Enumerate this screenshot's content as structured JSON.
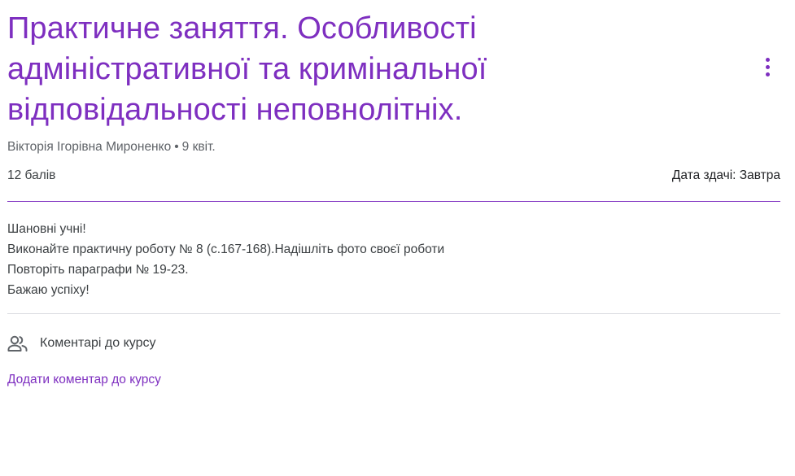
{
  "assignment": {
    "title": "Практичне заняття. Особливості адміністративної та кримінальної відповідальності неповнолітніх.",
    "author": "Вікторія Ігорівна Мироненко",
    "date": "9 квіт.",
    "separator": "•",
    "points": "12 балів",
    "due": "Дата здачі: Завтра"
  },
  "description": [
    "Шановні учні!",
    "Виконайте практичну роботу № 8 (с.167-168).Надішліть фото своєї роботи",
    "Повторіть параграфи № 19-23.",
    "Бажаю успіху!"
  ],
  "comments": {
    "header": "Коментарі до курсу",
    "header_icon": "people-icon",
    "add_link": "Додати коментар до курсу"
  },
  "menu": {
    "icon": "more-vert-icon"
  },
  "colors": {
    "accent": "#7e2fc0",
    "text": "#3c4043",
    "muted": "#5f6368",
    "divider": "#dadce0"
  }
}
